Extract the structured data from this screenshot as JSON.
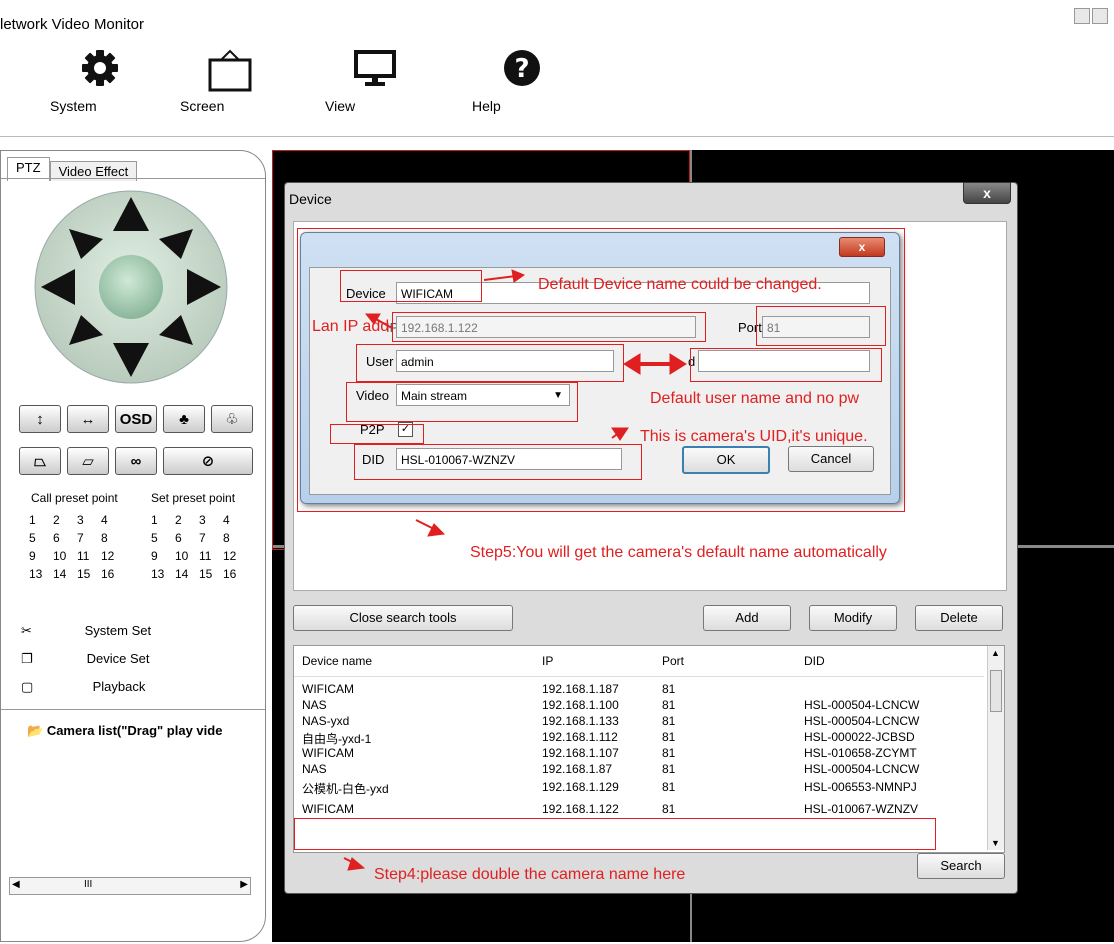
{
  "window": {
    "title": "letwork Video Monitor"
  },
  "toolbar": [
    {
      "label": "System",
      "icon": "gear-icon"
    },
    {
      "label": "Screen",
      "icon": "screen-frame-icon"
    },
    {
      "label": "View",
      "icon": "monitor-icon"
    },
    {
      "label": "Help",
      "icon": "help-icon"
    }
  ],
  "left_panel": {
    "tabs": [
      "PTZ",
      "Video Effect"
    ],
    "osd_label": "OSD",
    "call_preset": "Call preset point",
    "set_preset": "Set preset point",
    "preset_numbers": [
      "1",
      "2",
      "3",
      "4",
      "5",
      "6",
      "7",
      "8",
      "9",
      "10",
      "11",
      "12",
      "13",
      "14",
      "15",
      "16"
    ],
    "menu": [
      {
        "label": "System Set",
        "icon": "tools-icon"
      },
      {
        "label": "Device Set",
        "icon": "device-icon"
      },
      {
        "label": "Playback",
        "icon": "tv-icon"
      }
    ],
    "camera_list": "Camera list(\"Drag\" play vide",
    "scroll_grip": "III"
  },
  "device_window": {
    "title": "Device",
    "close": "x",
    "buttons": {
      "close_search": "Close search tools",
      "add": "Add",
      "modify": "Modify",
      "delete": "Delete",
      "search": "Search"
    },
    "columns": [
      "Device name",
      "IP",
      "Port",
      "DID"
    ],
    "rows": [
      [
        "WIFICAM",
        "192.168.1.187",
        "81",
        ""
      ],
      [
        "NAS",
        "192.168.1.100",
        "81",
        "HSL-000504-LCNCW"
      ],
      [
        "NAS-yxd",
        "192.168.1.133",
        "81",
        "HSL-000504-LCNCW"
      ],
      [
        "自由鸟-yxd-1",
        "192.168.1.112",
        "81",
        "HSL-000022-JCBSD"
      ],
      [
        "WIFICAM",
        "192.168.1.107",
        "81",
        "HSL-010658-ZCYMT"
      ],
      [
        "NAS",
        "192.168.1.87",
        "81",
        "HSL-000504-LCNCW"
      ],
      [
        "公模机-白色-yxd",
        "192.168.1.129",
        "81",
        "HSL-006553-NMNPJ"
      ],
      [
        "WIFICAM",
        "192.168.1.122",
        "81",
        "HSL-010067-WZNZV"
      ]
    ]
  },
  "dialog": {
    "close": "x",
    "device_label": "Device",
    "device_value": "WIFICAM",
    "ip_label": "IP",
    "ip_value": "192.168.1.122",
    "port_label": "Port",
    "port_value": "81",
    "user_label": "User",
    "user_value": "admin",
    "pwd_label": "d",
    "pwd_value": "",
    "video_label": "Video",
    "video_value": "Main stream",
    "p2p_label": "P2P",
    "p2p_check": "✓",
    "did_label": "DID",
    "did_value": "HSL-010067-WZNZV",
    "ok": "OK",
    "cancel": "Cancel"
  },
  "annotations": {
    "device_name": "Default Device name could be changed.",
    "lan_ip": "Lan IP add",
    "default_user": "Default user name and no pw",
    "uid": "This is camera's UID,it's unique.",
    "step5": "Step5:You will get the camera's default name automatically",
    "step4": "Step4:please double the camera name here"
  },
  "colors": {
    "annotation": "#e02020",
    "dialog_blue": "#b8d0ec",
    "window_gray": "#dcdcdc"
  }
}
